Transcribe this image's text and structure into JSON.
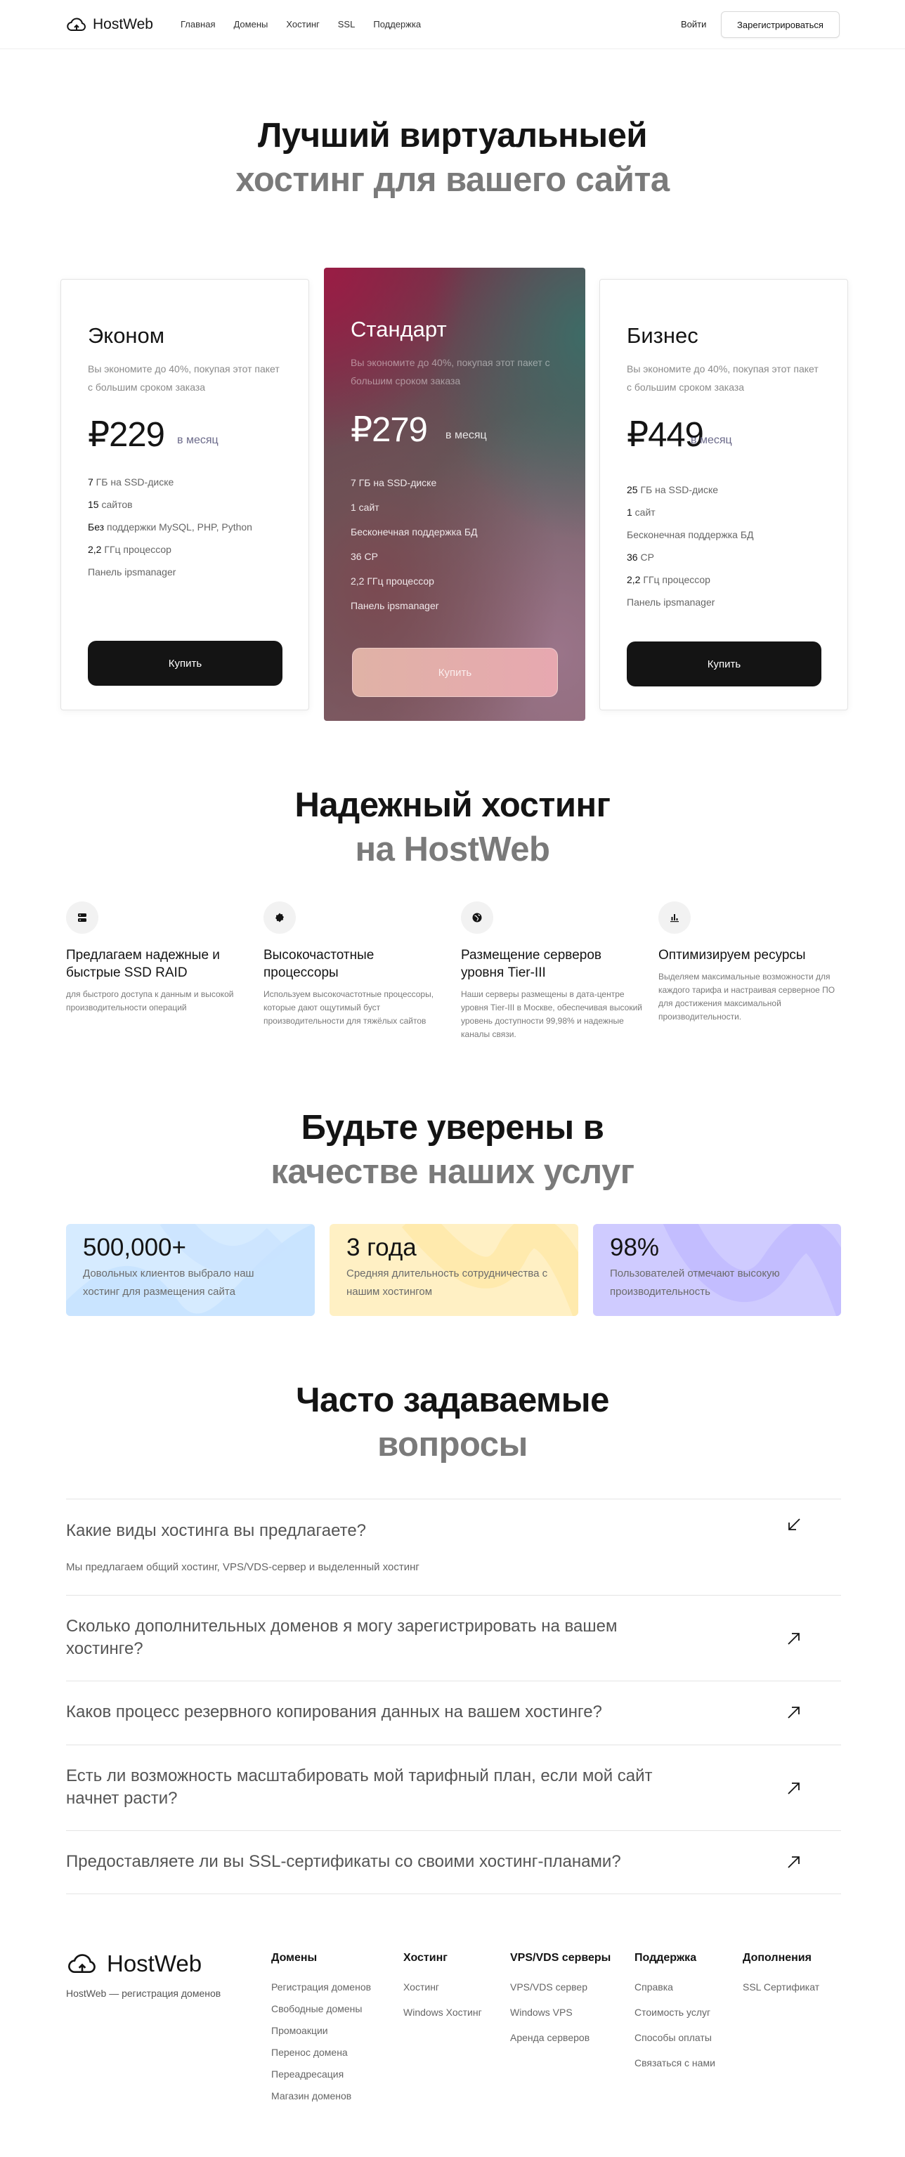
{
  "header": {
    "brand": "HostWeb",
    "nav": [
      "Главная",
      "Домены",
      "Хостинг",
      "SSL",
      "Поддержка"
    ],
    "login": "Войти",
    "signup": "Зарегистрироваться"
  },
  "hero": {
    "line1": "Лучший виртуальныей",
    "line2": "хостинг для вашего сайта"
  },
  "plans": [
    {
      "name": "Эконом",
      "desc": "Вы экономите до 40%, покупая этот пакет с большим сроком заказа",
      "price": "₽229",
      "period": "в месяц",
      "features": [
        {
          "strong": "7",
          "text": " ГБ на SSD-диске"
        },
        {
          "strong": "15",
          "text": " сайтов"
        },
        {
          "strong": "Без",
          "text": " поддержки MySQL, PHP, Python"
        },
        {
          "strong": "2,2",
          "text": " ГГц процессор"
        },
        {
          "strong": "",
          "text": "Панель ipsmanager"
        }
      ],
      "button": "Купить"
    },
    {
      "name": "Стандарт",
      "desc": "Вы экономите до 40%, покупая этот пакет с большим сроком заказа",
      "price": "₽279",
      "period": "в месяц",
      "features": [
        {
          "strong": "",
          "text": "7 ГБ на SSD-диске"
        },
        {
          "strong": "",
          "text": "1 сайт"
        },
        {
          "strong": "",
          "text": "Бесконечная поддержка БД"
        },
        {
          "strong": "",
          "text": "36 CP"
        },
        {
          "strong": "",
          "text": "2,2 ГГц процессор"
        },
        {
          "strong": "",
          "text": "Панель ipsmanager"
        }
      ],
      "button": "Купить"
    },
    {
      "name": "Бизнес",
      "desc": "Вы экономите до 40%, покупая этот пакет с большим сроком заказа",
      "price": "₽449",
      "period": "в месяц",
      "features": [
        {
          "strong": "25",
          "text": " ГБ на SSD-диске"
        },
        {
          "strong": "1",
          "text": " сайт"
        },
        {
          "strong": "",
          "text": "Бесконечная поддержка БД"
        },
        {
          "strong": "36",
          "text": " CP"
        },
        {
          "strong": "2,2",
          "text": " ГГц процессор"
        },
        {
          "strong": "",
          "text": "Панель ipsmanager"
        }
      ],
      "button": "Купить"
    }
  ],
  "reliable": {
    "line1": "Надежный хостинг",
    "line2": "на HostWeb"
  },
  "features": [
    {
      "icon": "server-icon",
      "title": "Предлагаем надежные и быстрые SSD RAID",
      "text": "для быстрого доступа к данным и высокой производительности операций"
    },
    {
      "icon": "cpu-icon",
      "title": "Высокочастотные процессоры",
      "text": "Используем высокочастотные процессоры, которые дают ощутимый буст производительности для тяжёлых сайтов"
    },
    {
      "icon": "globe-icon",
      "title": "Размещение серверов уровня Tier-III",
      "text": "Наши серверы размещены в дата-центре уровня Tier-III в Москве, обеспечивая высокий уровень доступности 99,98% и надежные каналы связи."
    },
    {
      "icon": "bar-chart-icon",
      "title": "Оптимизируем ресурсы",
      "text": "Выделяем максимальные возможности для каждого тарифа и настраивая серверное ПО для достижения максимальной производительности."
    }
  ],
  "quality": {
    "line1": "Будьте уверены в",
    "line2": "качестве наших услуг"
  },
  "stats": [
    {
      "value": "500,000+",
      "text": "Довольных клиентов выбрало наш хостинг для размещения сайта",
      "color": "#d6ebff"
    },
    {
      "value": "3 года",
      "text": "Средняя длительность сотрудничества с нашим хостингом",
      "color": "#fff0c4"
    },
    {
      "value": "98%",
      "text": "Пользователей отмечают высокую производительность",
      "color": "#cfcbff"
    }
  ],
  "faq_title": {
    "line1": "Часто задаваемые",
    "line2": "вопросы"
  },
  "faq": [
    {
      "q": "Какие виды хостинга вы предлагаете?",
      "a": "Мы предлагаем общий хостинг, VPS/VDS-сервер и выделенный хостинг",
      "open": true
    },
    {
      "q": "Сколько дополнительных доменов я могу зарегистрировать на вашем хостинге?",
      "a": "",
      "open": false
    },
    {
      "q": "Каков процесс резервного копирования данных на вашем хостинге?",
      "a": "",
      "open": false
    },
    {
      "q": "Есть ли возможность масштабировать мой тарифный план, если мой сайт начнет расти?",
      "a": "",
      "open": false
    },
    {
      "q": "Предоставляете ли вы SSL-сертификаты со своими хостинг-планами?",
      "a": "",
      "open": false
    }
  ],
  "footer": {
    "brand": "HostWeb",
    "tagline": "HostWeb — регистрация доменов",
    "columns": [
      {
        "title": "Домены",
        "links": [
          "Регистрация доменов",
          "Свободные домены",
          "Промоакции",
          "Перенос домена",
          "Переадресация",
          "Магазин доменов"
        ]
      },
      {
        "title": "Хостинг",
        "links": [
          "Хостинг",
          "Windows Хостинг"
        ]
      },
      {
        "title": "VPS/VDS серверы",
        "links": [
          "VPS/VDS сервер",
          "Windows VPS",
          "Аренда серверов"
        ]
      },
      {
        "title": "Поддержка",
        "links": [
          "Справка",
          "Стоимость услуг",
          "Способы оплаты",
          "Связаться с нами"
        ]
      },
      {
        "title": "Дополнения",
        "links": [
          "SSL Сертификат"
        ]
      }
    ]
  }
}
